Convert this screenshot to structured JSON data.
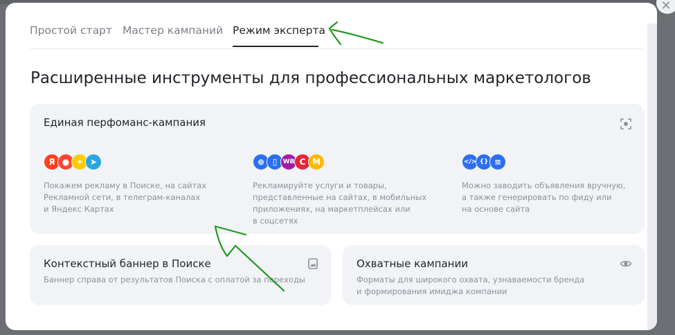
{
  "tabs": [
    {
      "label": "Простой старт",
      "active": false
    },
    {
      "label": "Мастер кампаний",
      "active": false
    },
    {
      "label": "Режим эксперта",
      "active": true
    }
  ],
  "heading": "Расширенные инструменты для профессиональных маркетологов",
  "cards": {
    "unified": {
      "title": "Единая перфоманс-кампания",
      "corner_icon": "expand-icon",
      "columns": [
        {
          "logos": [
            {
              "name": "yandex-logo-icon",
              "glyph": "Я",
              "color": "#fc3f1d"
            },
            {
              "name": "maps-pin-icon",
              "glyph": "●",
              "color": "#ff4433"
            },
            {
              "name": "star-logo-icon",
              "glyph": "✦",
              "color": "#ffcc00"
            },
            {
              "name": "telegram-icon",
              "glyph": "➤",
              "color": "#2aa6e0"
            }
          ],
          "description": "Покажем рекламу в Поиске, на сайтах\nРекламной сети, в телеграм-каналах\nи Яндекс Картах"
        },
        {
          "logos": [
            {
              "name": "globe-icon",
              "glyph": "⊕",
              "color": "#2c6ff0"
            },
            {
              "name": "phone-icon",
              "glyph": "▯",
              "color": "#2c6ff0"
            },
            {
              "name": "wildberries-logo-icon",
              "glyph": "WB",
              "color": "#a21aa8"
            },
            {
              "name": "ozon-logo-icon",
              "glyph": "C",
              "color": "#e6253b"
            },
            {
              "name": "yandex-market-logo-icon",
              "glyph": "M",
              "color": "#ffb800"
            }
          ],
          "description": "Рекламируйте услуги и товары,\nпредставленные на сайтах, в мобильных\nприложениях, на маркетплейсах или\nв соцсетях"
        },
        {
          "logos": [
            {
              "name": "code-icon",
              "glyph": "</>",
              "color": "#2c6ff0"
            },
            {
              "name": "braces-icon",
              "glyph": "{}",
              "color": "#2c6ff0"
            },
            {
              "name": "document-icon",
              "glyph": "≡",
              "color": "#2c6ff0"
            }
          ],
          "description": "Можно заводить объявления вручную,\nа также генерировать по фиду или\nна основе сайта"
        }
      ]
    },
    "banner": {
      "title": "Контекстный баннер в Поиске",
      "description": "Баннер справа от результатов Поиска с оплатой за переходы",
      "corner_icon": "image-icon"
    },
    "reach": {
      "title": "Охватные кампании",
      "description": "Форматы для широкого охвата, узнаваемости бренда\nи формирования имиджа компании",
      "corner_icon": "eye-icon"
    }
  },
  "close": {
    "glyph": "✕",
    "icon": "close-icon"
  },
  "colors": {
    "card_bg": "#f1f3f7",
    "text_primary": "#1f2328",
    "text_secondary": "#8c9199",
    "annotation": "#1d9a1d"
  }
}
